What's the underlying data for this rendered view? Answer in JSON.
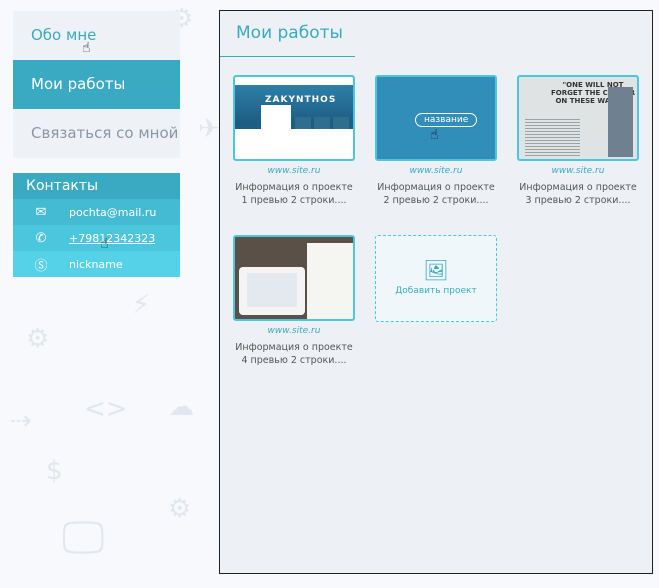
{
  "nav": {
    "about": "Обо мне",
    "works": "Мои работы",
    "contact": "Связаться со мной"
  },
  "contacts": {
    "title": "Контакты",
    "email": "pochta@mail.ru",
    "phone": "+79812342323",
    "skype": "nickname"
  },
  "main": {
    "title": "Мои работы",
    "projects": [
      {
        "site": "www.site.ru",
        "info_line1": "Информация о проекте",
        "info_line2": "1 превью 2 строки...."
      },
      {
        "site": "www.site.ru",
        "info_line1": "Информация о проекте",
        "info_line2": "2 превью 2 строки....",
        "overlay_label": "название"
      },
      {
        "site": "www.site.ru",
        "info_line1": "Информация о проекте",
        "info_line2": "3 превью 2 строки...."
      },
      {
        "site": "www.site.ru",
        "info_line1": "Информация о проекте",
        "info_line2": "4 превью 2 строки...."
      }
    ],
    "thumb1_brand": "ZAKYNTHOS",
    "thumb3_quote": "\"ONE WILL NOT FORGET THE COLOUR ON THESE WALLS.\"",
    "add_project": "Добавить проект"
  },
  "colors": {
    "accent": "#3aa9c2",
    "contact_bg": "#4cc6dd",
    "panel_bg": "#edf0f5"
  }
}
